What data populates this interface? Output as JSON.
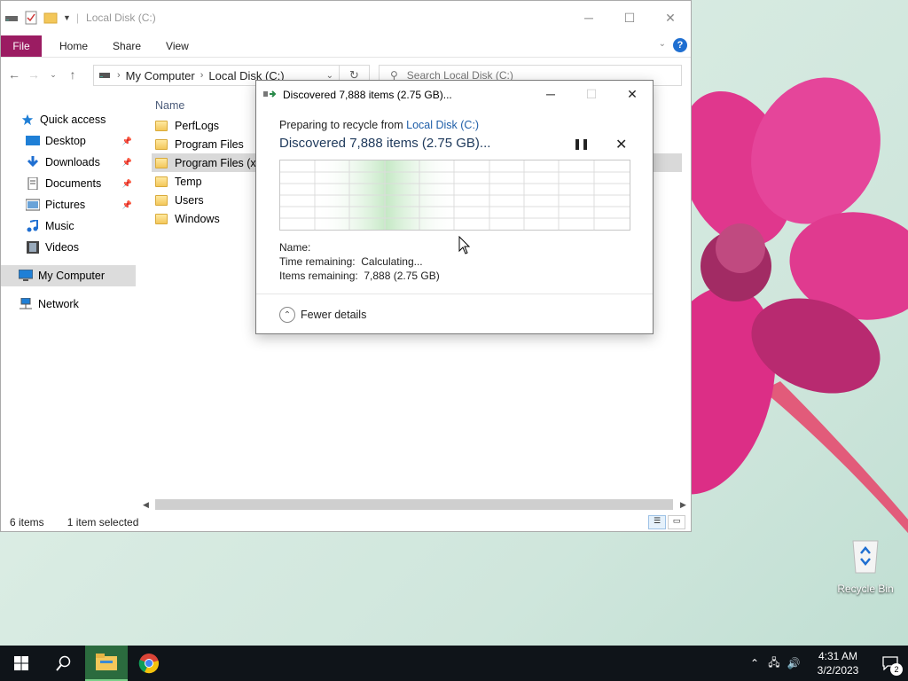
{
  "explorer": {
    "title": "Local Disk (C:)",
    "ribbon_tabs": [
      "File",
      "Home",
      "Share",
      "View"
    ],
    "breadcrumb": [
      "My Computer",
      "Local Disk (C:)"
    ],
    "search_placeholder": "Search Local Disk (C:)",
    "nav": [
      {
        "label": "Quick access",
        "icon": "star-icon"
      },
      {
        "label": "Desktop",
        "icon": "desktop-icon",
        "pinned": true
      },
      {
        "label": "Downloads",
        "icon": "download-icon",
        "pinned": true
      },
      {
        "label": "Documents",
        "icon": "documents-icon",
        "pinned": true
      },
      {
        "label": "Pictures",
        "icon": "pictures-icon",
        "pinned": true
      },
      {
        "label": "Music",
        "icon": "music-icon"
      },
      {
        "label": "Videos",
        "icon": "videos-icon"
      },
      {
        "label": "My Computer",
        "icon": "computer-icon",
        "selected": true
      },
      {
        "label": "Network",
        "icon": "network-icon"
      }
    ],
    "column_header": "Name",
    "files": [
      "PerfLogs",
      "Program Files",
      "Program Files (x86)",
      "Temp",
      "Users",
      "Windows"
    ],
    "selected_file_index": 2,
    "status": {
      "count": "6 items",
      "selection": "1 item selected"
    }
  },
  "dialog": {
    "title": "Discovered 7,888 items (2.75 GB)...",
    "preparing_prefix": "Preparing to recycle from",
    "preparing_link": "Local Disk (C:)",
    "heading": "Discovered 7,888 items (2.75 GB)...",
    "name_label": "Name:",
    "time_label": "Time remaining:",
    "time_value": "Calculating...",
    "items_label": "Items remaining:",
    "items_value": "7,888 (2.75 GB)",
    "fewer_details": "Fewer details"
  },
  "desktop": {
    "recycle_bin_label": "Recycle Bin"
  },
  "taskbar": {
    "time": "4:31 AM",
    "date": "3/2/2023",
    "notifications": "2"
  },
  "colors": {
    "file_tab": "#9b1c62",
    "accent": "#1f6fd1",
    "taskbar": "#0f1419"
  }
}
